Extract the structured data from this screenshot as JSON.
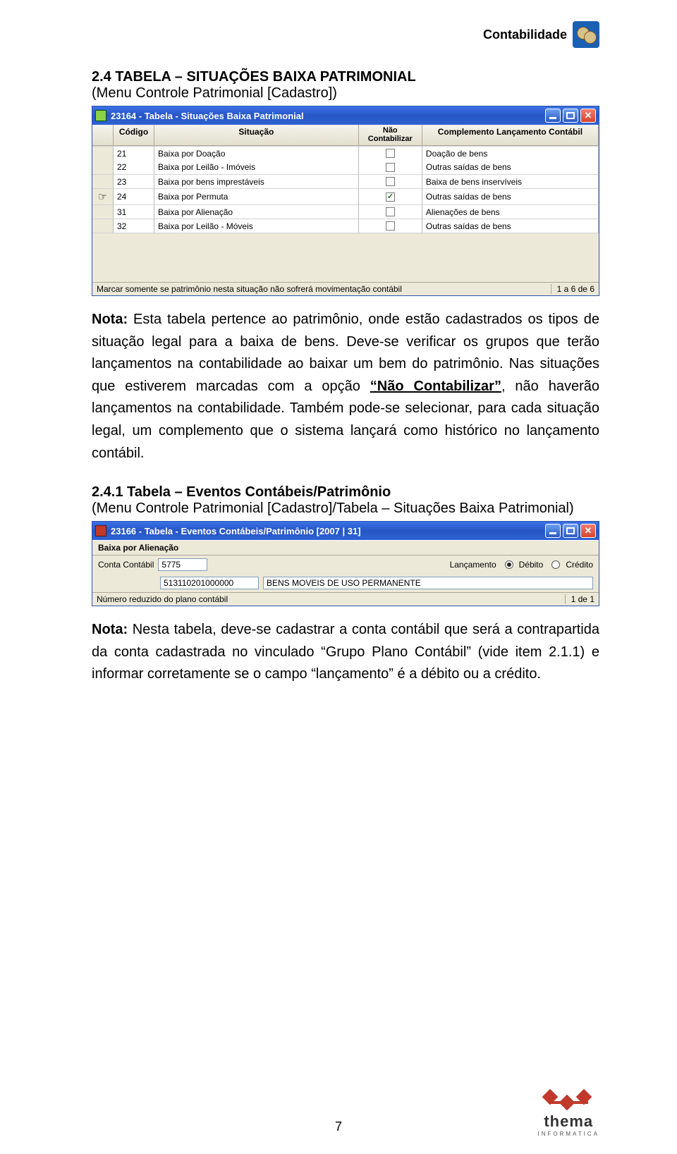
{
  "header": {
    "title": "Contabilidade"
  },
  "section24": {
    "heading": "2.4 TABELA – SITUAÇÕES BAIXA PATRIMONIAL",
    "sub": "(Menu Controle Patrimonial [Cadastro])"
  },
  "win1": {
    "title": "23164 - Tabela - Situações Baixa Patrimonial",
    "cols": {
      "c2": "Código",
      "c3": "Situação",
      "c4": "Não Contabilizar",
      "c5": "Complemento Lançamento Contábil"
    },
    "rows": [
      {
        "ptr": "",
        "codigo": "21",
        "situacao": "Baixa por Doação",
        "nc": false,
        "comp": "Doação de bens"
      },
      {
        "ptr": "",
        "codigo": "22",
        "situacao": "Baixa por Leilão - Imóveis",
        "nc": false,
        "comp": "Outras saídas de bens"
      },
      {
        "ptr": "",
        "codigo": "23",
        "situacao": "Baixa por bens imprestáveis",
        "nc": false,
        "comp": "Baixa de bens inservíveis"
      },
      {
        "ptr": "☞",
        "codigo": "24",
        "situacao": "Baixa por Permuta",
        "nc": true,
        "comp": "Outras saídas de bens"
      },
      {
        "ptr": "",
        "codigo": "31",
        "situacao": "Baixa por Alienação",
        "nc": false,
        "comp": "Alienações de bens"
      },
      {
        "ptr": "",
        "codigo": "32",
        "situacao": "Baixa por Leilão - Móveis",
        "nc": false,
        "comp": "Outras saídas de bens"
      }
    ],
    "status_left": "Marcar somente se patrimônio nesta situação não sofrerá movimentação contábil",
    "status_right": "1 a 6 de 6"
  },
  "note1_parts": {
    "lead": "Nota:",
    "p1": " Esta tabela pertence ao patrimônio, onde estão cadastrados os tipos de situação legal para a baixa de bens. Deve-se verificar os grupos que terão lançamentos na contabilidade ao baixar um bem do patrimônio. Nas situações que estiverem marcadas com a opção ",
    "uq1": "“Não Contabilizar”",
    "p2": ", não haverão lançamentos na contabilidade. Também pode-se selecionar, para cada situação legal, um complemento que o sistema lançará como histórico no lançamento contábil."
  },
  "section241": {
    "heading": "2.4.1 Tabela – Eventos Contábeis/Patrimônio",
    "sub": "(Menu Controle Patrimonial [Cadastro]/Tabela – Situações Baixa Patrimonial)"
  },
  "win2": {
    "title": "23166 - Tabela - Eventos Contábeis/Patrimônio [2007 | 31]",
    "subhdr": "Baixa por Alienação",
    "lbl_conta": "Conta Contábil",
    "conta_val": "5775",
    "lbl_lanc": "Lançamento",
    "opt_deb": "Débito",
    "opt_cre": "Crédito",
    "code": "513110201000000",
    "code_desc": "BENS MOVEIS DE USO PERMANENTE",
    "status_left": "Número reduzido do plano contábil",
    "status_right": "1 de 1"
  },
  "note2_parts": {
    "lead": "Nota:",
    "body": " Nesta tabela, deve-se cadastrar a conta contábil que será a contrapartida da conta cadastrada no vinculado “Grupo Plano Contábil” (vide item 2.1.1) e informar corretamente se o campo “lançamento” é a débito ou a crédito."
  },
  "page_number": "7",
  "logo": {
    "name": "thema",
    "sub": "INFORMATICA"
  }
}
